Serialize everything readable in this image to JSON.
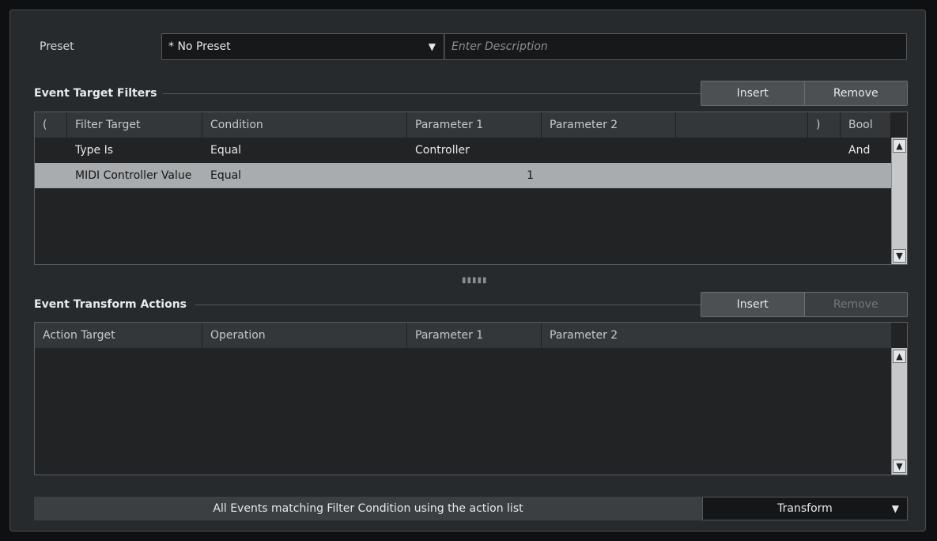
{
  "preset": {
    "label": "Preset",
    "selected": "* No Preset",
    "description_placeholder": "Enter Description"
  },
  "filters": {
    "title": "Event Target Filters",
    "insert_label": "Insert",
    "remove_label": "Remove",
    "columns": [
      "(",
      "Filter Target",
      "Condition",
      "Parameter 1",
      "Parameter 2",
      "",
      ")",
      "Bool"
    ],
    "rows": [
      {
        "open": "",
        "target": "Type Is",
        "condition": "Equal",
        "param1": "Controller",
        "param2": "",
        "close": "",
        "bool": "And",
        "selected": false
      },
      {
        "open": "",
        "target": "MIDI Controller Value",
        "condition": "Equal",
        "param1": "1",
        "param2": "",
        "close": "",
        "bool": "",
        "selected": true
      }
    ]
  },
  "actions": {
    "title": "Event Transform Actions",
    "insert_label": "Insert",
    "remove_label": "Remove",
    "remove_enabled": false,
    "columns": [
      "Action Target",
      "Operation",
      "Parameter 1",
      "Parameter 2"
    ],
    "rows": []
  },
  "footer": {
    "description": "All Events matching Filter Condition using the action list",
    "function": "Transform"
  },
  "icons": {
    "dropdown": "triangle-down-icon",
    "scroll_up": "chevron-up-icon",
    "scroll_down": "chevron-down-icon",
    "splitter": "drag-handle-icon"
  }
}
